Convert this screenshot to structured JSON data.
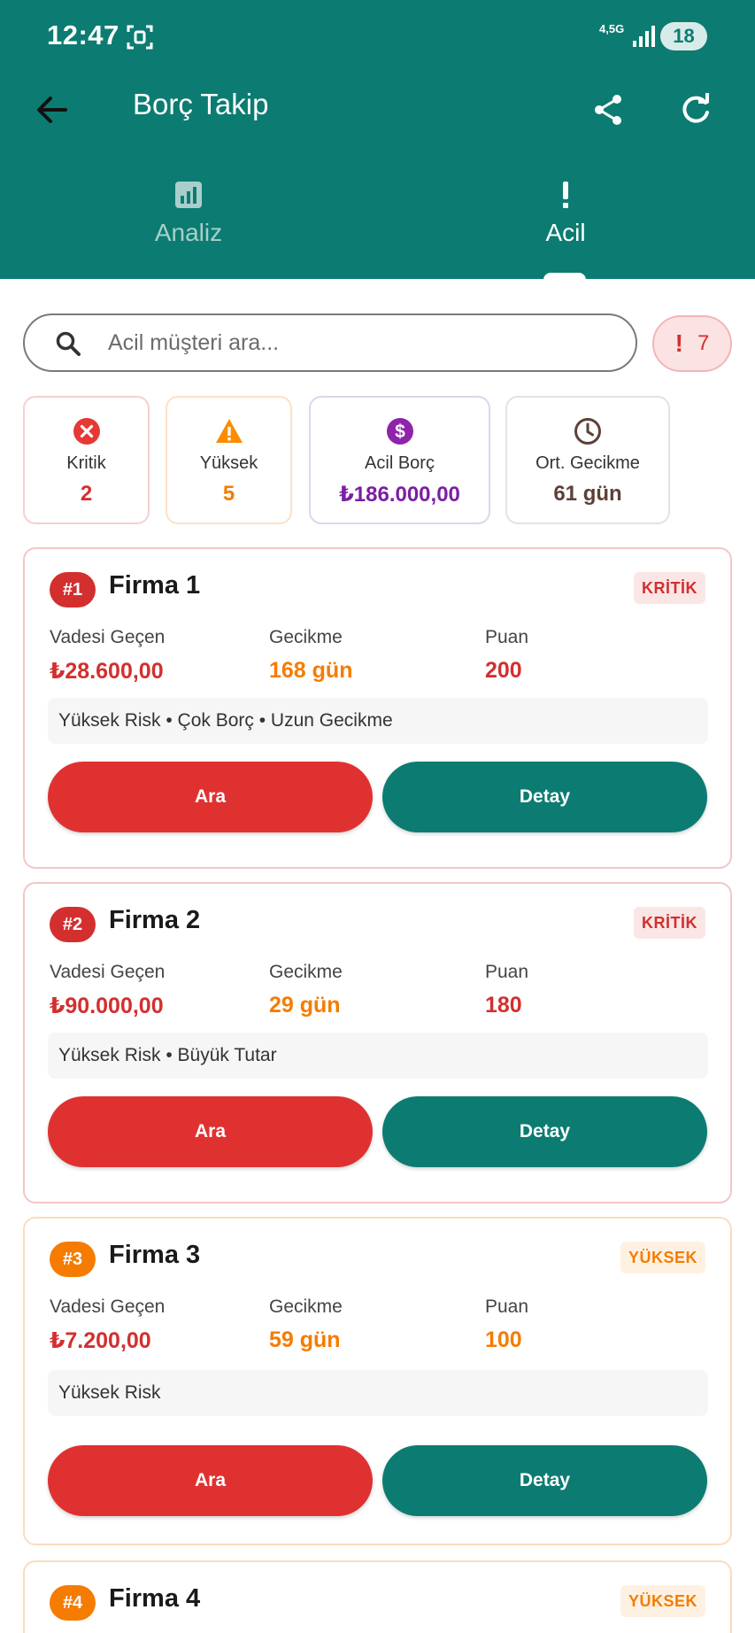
{
  "status_bar": {
    "time": "12:47",
    "network": "4,5G",
    "battery": "18"
  },
  "toolbar": {
    "title": "Borç Takip"
  },
  "tabs": [
    {
      "label": "Analiz",
      "icon": "bar-chart-icon",
      "selected": false
    },
    {
      "label": "Acil",
      "icon": "exclamation-icon",
      "selected": true
    }
  ],
  "search": {
    "placeholder": "Acil müşteri ara...",
    "value": ""
  },
  "alert_chip": {
    "icon": "!",
    "count": "7"
  },
  "stats": {
    "kritik": {
      "label": "Kritik",
      "value": "2",
      "color": "#d32f2f"
    },
    "yuksek": {
      "label": "Yüksek",
      "value": "5",
      "color": "#f57c00"
    },
    "acil_borc": {
      "label": "Acil Borç",
      "value": "₺186.000,00",
      "color": "#7b1fa2"
    },
    "ort_gecikme": {
      "label": "Ort. Gecikme",
      "value": "61 gün",
      "color": "#5d4037"
    }
  },
  "customers": [
    {
      "rank": "#1",
      "name": "Firma 1",
      "level": "KRİTİK",
      "overdue_label": "Vadesi Geçen",
      "overdue": "₺28.600,00",
      "delay_label": "Gecikme",
      "delay": "168 gün",
      "score_label": "Puan",
      "score": "200",
      "tags": "Yüksek Risk • Çok Borç • Uzun Gecikme",
      "call_label": "Ara",
      "detail_label": "Detay"
    },
    {
      "rank": "#2",
      "name": "Firma 2",
      "level": "KRİTİK",
      "overdue_label": "Vadesi Geçen",
      "overdue": "₺90.000,00",
      "delay_label": "Gecikme",
      "delay": "29 gün",
      "score_label": "Puan",
      "score": "180",
      "tags": "Yüksek Risk • Büyük Tutar",
      "call_label": "Ara",
      "detail_label": "Detay"
    },
    {
      "rank": "#3",
      "name": "Firma 3",
      "level": "YÜKSEK",
      "overdue_label": "Vadesi Geçen",
      "overdue": "₺7.200,00",
      "delay_label": "Gecikme",
      "delay": "59 gün",
      "score_label": "Puan",
      "score": "100",
      "tags": "Yüksek Risk",
      "call_label": "Ara",
      "detail_label": "Detay"
    },
    {
      "rank": "#4",
      "name": "Firma 4",
      "level": "YÜKSEK"
    }
  ],
  "colors": {
    "primary": "#0c7c72",
    "critical": "#d32f2f",
    "high": "#f57c00",
    "debt": "#7b1fa2"
  }
}
